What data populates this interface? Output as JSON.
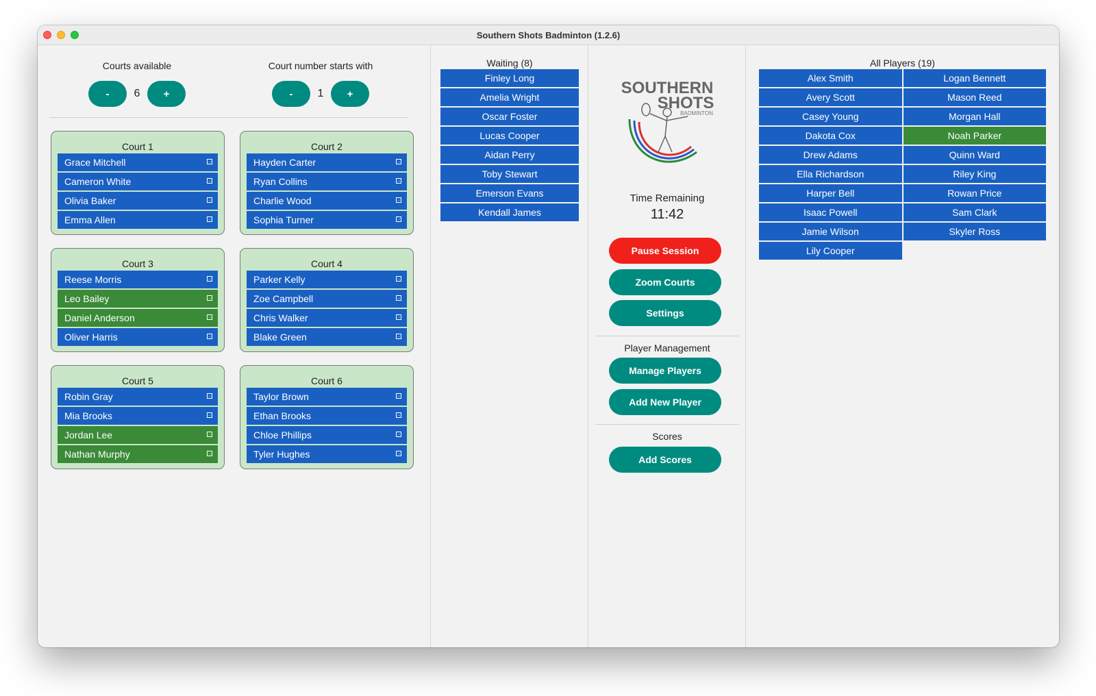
{
  "window": {
    "title": "Southern Shots Badminton (1.2.6)"
  },
  "settings": {
    "courts_available": {
      "label": "Courts available",
      "value": "6",
      "minus": "-",
      "plus": "+"
    },
    "court_start": {
      "label": "Court number starts with",
      "value": "1",
      "minus": "-",
      "plus": "+"
    }
  },
  "courts": [
    {
      "title": "Court 1",
      "players": [
        {
          "name": "Grace Mitchell",
          "status": "blue"
        },
        {
          "name": "Cameron White",
          "status": "blue"
        },
        {
          "name": "Olivia Baker",
          "status": "blue"
        },
        {
          "name": "Emma Allen",
          "status": "blue"
        }
      ]
    },
    {
      "title": "Court 2",
      "players": [
        {
          "name": "Hayden Carter",
          "status": "blue"
        },
        {
          "name": "Ryan Collins",
          "status": "blue"
        },
        {
          "name": "Charlie Wood",
          "status": "blue"
        },
        {
          "name": "Sophia Turner",
          "status": "blue"
        }
      ]
    },
    {
      "title": "Court 3",
      "players": [
        {
          "name": "Reese Morris",
          "status": "blue"
        },
        {
          "name": "Leo Bailey",
          "status": "green"
        },
        {
          "name": "Daniel Anderson",
          "status": "green"
        },
        {
          "name": "Oliver Harris",
          "status": "blue"
        }
      ]
    },
    {
      "title": "Court 4",
      "players": [
        {
          "name": "Parker Kelly",
          "status": "blue"
        },
        {
          "name": "Zoe Campbell",
          "status": "blue"
        },
        {
          "name": "Chris Walker",
          "status": "blue"
        },
        {
          "name": "Blake Green",
          "status": "blue"
        }
      ]
    },
    {
      "title": "Court 5",
      "players": [
        {
          "name": "Robin Gray",
          "status": "blue"
        },
        {
          "name": "Mia Brooks",
          "status": "blue"
        },
        {
          "name": "Jordan Lee",
          "status": "green"
        },
        {
          "name": "Nathan Murphy",
          "status": "green"
        }
      ]
    },
    {
      "title": "Court 6",
      "players": [
        {
          "name": "Taylor Brown",
          "status": "blue"
        },
        {
          "name": "Ethan Brooks",
          "status": "blue"
        },
        {
          "name": "Chloe Phillips",
          "status": "blue"
        },
        {
          "name": "Tyler Hughes",
          "status": "blue"
        }
      ]
    }
  ],
  "move_icon": "move-to-icon",
  "waiting": {
    "title": "Waiting (8)",
    "players": [
      "Finley Long",
      "Amelia Wright",
      "Oscar Foster",
      "Lucas Cooper",
      "Aidan Perry",
      "Toby Stewart",
      "Emerson Evans",
      "Kendall James"
    ]
  },
  "controls": {
    "logo": {
      "line1": "SOUTHERN",
      "line2": "SHOTS",
      "line3": "BADMINTON"
    },
    "time_label": "Time Remaining",
    "time_value": "11:42",
    "pause_label": "Pause Session",
    "zoom_label": "Zoom Courts",
    "settings_label": "Settings",
    "player_mgmt_label": "Player Management",
    "manage_label": "Manage Players",
    "add_player_label": "Add New Player",
    "scores_label": "Scores",
    "add_scores_label": "Add Scores"
  },
  "all_players": {
    "title": "All Players (19)",
    "players": [
      {
        "name": "Alex Smith",
        "status": "blue"
      },
      {
        "name": "Logan Bennett",
        "status": "blue"
      },
      {
        "name": "Avery Scott",
        "status": "blue"
      },
      {
        "name": "Mason Reed",
        "status": "blue"
      },
      {
        "name": "Casey Young",
        "status": "blue"
      },
      {
        "name": "Morgan Hall",
        "status": "blue"
      },
      {
        "name": "Dakota Cox",
        "status": "blue"
      },
      {
        "name": "Noah Parker",
        "status": "green"
      },
      {
        "name": "Drew Adams",
        "status": "blue"
      },
      {
        "name": "Quinn Ward",
        "status": "blue"
      },
      {
        "name": "Ella Richardson",
        "status": "blue"
      },
      {
        "name": "Riley King",
        "status": "blue"
      },
      {
        "name": "Harper Bell",
        "status": "blue"
      },
      {
        "name": "Rowan Price",
        "status": "blue"
      },
      {
        "name": "Isaac Powell",
        "status": "blue"
      },
      {
        "name": "Sam Clark",
        "status": "blue"
      },
      {
        "name": "Jamie Wilson",
        "status": "blue"
      },
      {
        "name": "Skyler Ross",
        "status": "blue"
      },
      {
        "name": "Lily Cooper",
        "status": "blue"
      }
    ]
  },
  "colors": {
    "accent": "#008b80",
    "player_blue": "#1a60c2",
    "player_green": "#3a8a38",
    "court_bg": "#c9e6c9",
    "pause_red": "#f0201a"
  }
}
